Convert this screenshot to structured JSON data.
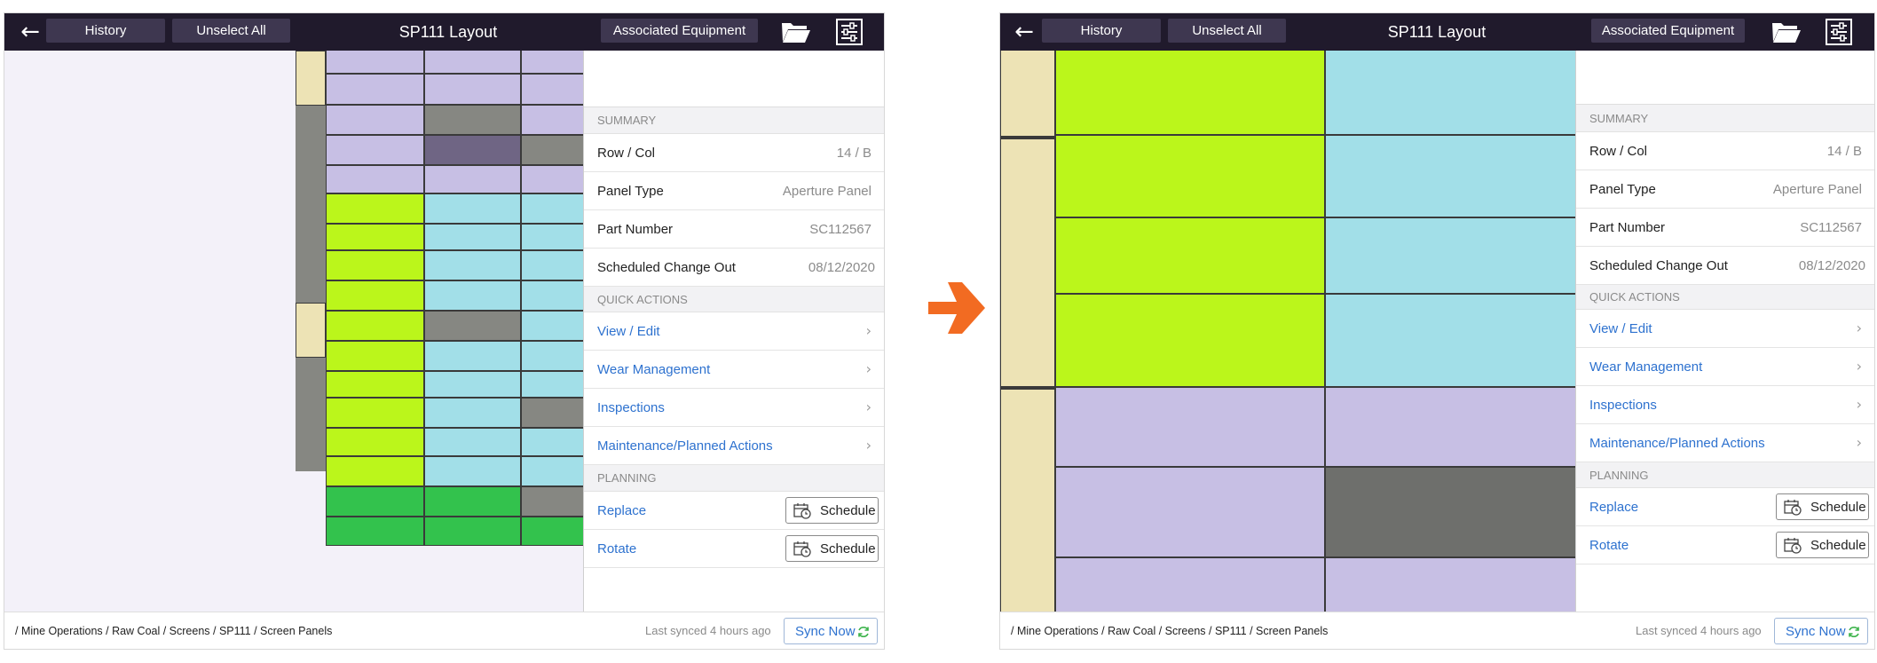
{
  "colors": {
    "topbar": "#201a2c",
    "button": "#3e3750",
    "link": "#2e72cf",
    "arrow": "#f26b22",
    "purple": "#c7bfe4",
    "lime": "#bbf61b",
    "cyan": "#a2dfe8",
    "green": "#33c24d",
    "grey": "#868782",
    "beige": "#ede3b5"
  },
  "left": {
    "topbar": {
      "back_icon": "arrow-left-icon",
      "history_label": "History",
      "unselect_label": "Unselect All",
      "title": "SP111 Layout",
      "equipment_label": "Associated Equipment",
      "folder_icon": "folder-open-icon",
      "settings_icon": "sliders-icon"
    },
    "panel": {
      "summary_header": "SUMMARY",
      "rows": [
        {
          "label": "Row / Col",
          "value": "14 / B"
        },
        {
          "label": "Panel Type",
          "value": "Aperture Panel"
        },
        {
          "label": "Part Number",
          "value": "SC112567"
        },
        {
          "label": "Scheduled Change Out",
          "value": "08/12/2020"
        }
      ],
      "quick_header": "QUICK ACTIONS",
      "actions": [
        "View / Edit",
        "Wear Management",
        "Inspections",
        "Maintenance/Planned Actions"
      ],
      "planning_header": "PLANNING",
      "planning": [
        {
          "label": "Replace",
          "button": "Schedule"
        },
        {
          "label": "Rotate",
          "button": "Schedule"
        }
      ]
    },
    "footer": {
      "breadcrumb": "/ Mine Operations / Raw Coal / Screens / SP111 / Screen Panels",
      "last_synced": "Last synced 4 hours ago",
      "sync_label": "Sync Now"
    }
  },
  "right": {
    "topbar": {
      "back_icon": "arrow-left-icon",
      "history_label": "History",
      "unselect_label": "Unselect All",
      "title": "SP111 Layout",
      "equipment_label": "Associated Equipment",
      "folder_icon": "folder-open-icon",
      "settings_icon": "sliders-icon"
    },
    "panel": {
      "summary_header": "SUMMARY",
      "rows": [
        {
          "label": "Row / Col",
          "value": "14 / B"
        },
        {
          "label": "Panel Type",
          "value": "Aperture Panel"
        },
        {
          "label": "Part Number",
          "value": "SC112567"
        },
        {
          "label": "Scheduled Change Out",
          "value": "08/12/2020"
        }
      ],
      "quick_header": "QUICK ACTIONS",
      "actions": [
        "View / Edit",
        "Wear Management",
        "Inspections",
        "Maintenance/Planned Actions"
      ],
      "planning_header": "PLANNING",
      "planning": [
        {
          "label": "Replace",
          "button": "Schedule"
        },
        {
          "label": "Rotate",
          "button": "Schedule"
        }
      ]
    },
    "footer": {
      "breadcrumb": "/ Mine Operations / Raw Coal / Screens / SP111 / Screen Panels",
      "last_synced": "Last synced 4 hours ago",
      "sync_label": "Sync Now"
    }
  },
  "transition_icon": "arrow-right-icon"
}
